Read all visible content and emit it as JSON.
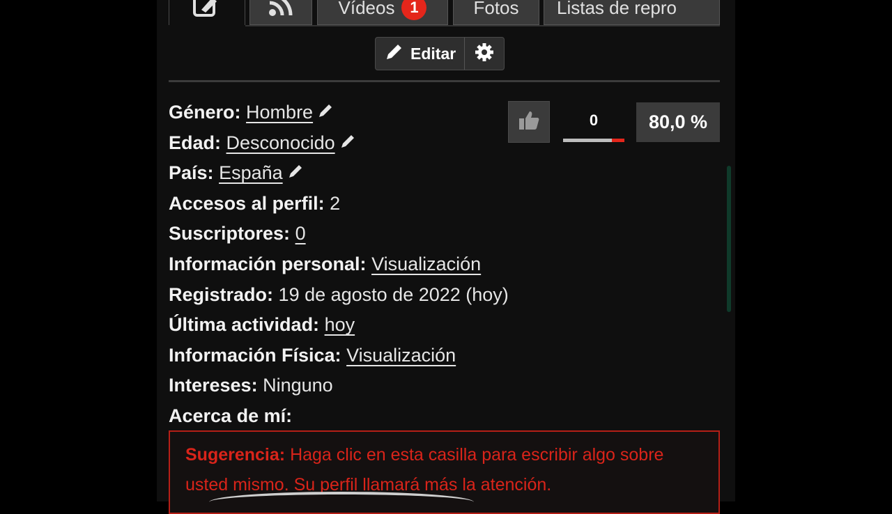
{
  "tabs": [
    {
      "label": "",
      "icon": "edit-icon"
    },
    {
      "label": "",
      "icon": "rss-icon"
    },
    {
      "label": "Vídeos",
      "badge": "1"
    },
    {
      "label": "Fotos"
    },
    {
      "label": "Listas de repro"
    }
  ],
  "toolbar": {
    "edit_label": "Editar"
  },
  "profile": {
    "gender_label": "Género:",
    "gender_value": "Hombre",
    "age_label": "Edad:",
    "age_value": "Desconocido",
    "country_label": "País:",
    "country_value": "España",
    "views_label": "Accesos al perfil:",
    "views_value": "2",
    "subs_label": "Suscriptores:",
    "subs_value": "0",
    "personal_label": "Información personal:",
    "personal_value": "Visualización",
    "registered_label": "Registrado:",
    "registered_value": "19 de agosto de 2022 (hoy)",
    "last_label": "Última actividad:",
    "last_value": "hoy",
    "physical_label": "Información Física:",
    "physical_value": "Visualización",
    "interests_label": "Intereses:",
    "interests_value": "Ninguno",
    "about_label": "Acerca de mí:"
  },
  "rating": {
    "likes": "0",
    "percent": "80,0 %",
    "dislike_fraction": 0.2
  },
  "suggestion": {
    "label": "Sugerencia:",
    "text": "Haga clic en esta casilla para escribir algo sobre usted mismo. Su perfil llamará más la atención."
  },
  "colors": {
    "accent_red": "#e4261b",
    "background": "#0f0f0f"
  }
}
